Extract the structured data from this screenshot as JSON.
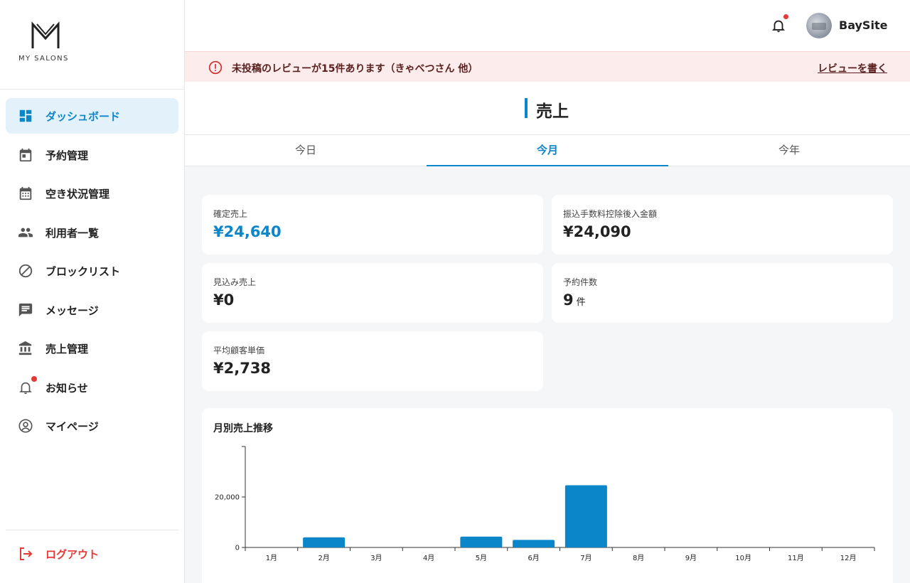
{
  "sidebar": {
    "logo_text": "MY SALONS",
    "items": [
      {
        "label": "ダッシュボード",
        "icon": "dashboard-icon"
      },
      {
        "label": "予約管理",
        "icon": "calendar-icon"
      },
      {
        "label": "空き状況管理",
        "icon": "calendar-grid-icon"
      },
      {
        "label": "利用者一覧",
        "icon": "people-icon"
      },
      {
        "label": "ブロックリスト",
        "icon": "block-icon"
      },
      {
        "label": "メッセージ",
        "icon": "message-icon"
      },
      {
        "label": "売上管理",
        "icon": "bank-icon"
      },
      {
        "label": "お知らせ",
        "icon": "bell-icon"
      },
      {
        "label": "マイページ",
        "icon": "account-circle-icon"
      }
    ],
    "logout_label": "ログアウト"
  },
  "header": {
    "username": "BaySite"
  },
  "alert": {
    "message": "未投稿のレビューが15件あります（きゃべつさん 他）",
    "link_label": "レビューを書く"
  },
  "page": {
    "title": "売上",
    "tabs": [
      "今日",
      "今月",
      "今年"
    ],
    "active_tab": "今月"
  },
  "stats": {
    "confirmed_sales": {
      "label": "確定売上",
      "value": "¥24,640"
    },
    "net_after_fee": {
      "label": "振込手数料控除後入金額",
      "value": "¥24,090"
    },
    "expected_sales": {
      "label": "見込み売上",
      "value": "¥0"
    },
    "reservations": {
      "label": "予約件数",
      "value": "9",
      "unit": "件"
    },
    "avg_price": {
      "label": "平均顧客単価",
      "value": "¥2,738"
    }
  },
  "colors": {
    "accent": "#0a86c9",
    "alert_bg": "#fdecec",
    "danger": "#e53935"
  },
  "chart_data": {
    "type": "bar",
    "title": "月別売上推移",
    "categories": [
      "1月",
      "2月",
      "3月",
      "4月",
      "5月",
      "6月",
      "7月",
      "8月",
      "9月",
      "10月",
      "11月",
      "12月"
    ],
    "values": [
      0,
      4000,
      0,
      0,
      4300,
      3000,
      24640,
      0,
      0,
      0,
      0,
      0
    ],
    "yticks": [
      0,
      20000
    ],
    "ytick_labels": [
      "0",
      "20,000"
    ],
    "ylim": [
      0,
      40000
    ],
    "grid": false,
    "color": "#0a86c9"
  }
}
